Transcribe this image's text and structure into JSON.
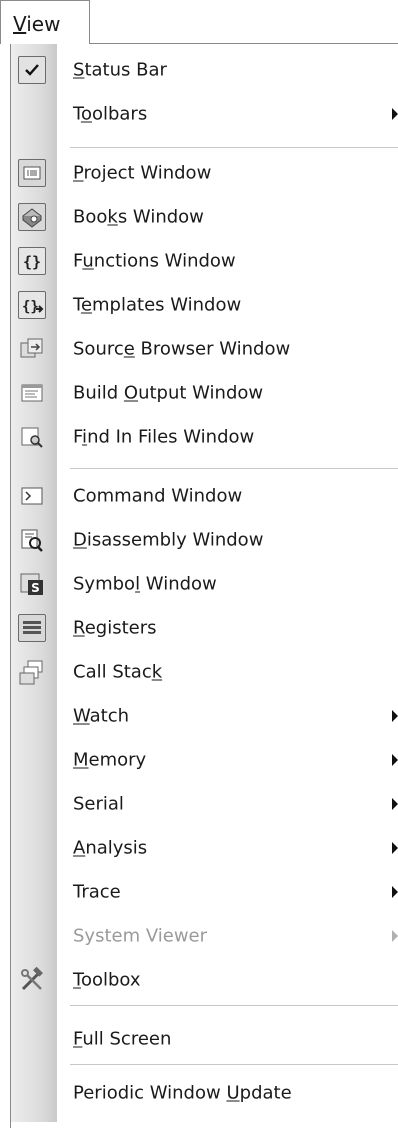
{
  "menubar": {
    "label_prefix": "",
    "label_underline": "V",
    "label_suffix": "iew"
  },
  "items": [
    {
      "pre": "",
      "u": "S",
      "post": "tatus Bar"
    },
    {
      "pre": "T",
      "u": "o",
      "post": "olbars"
    },
    {
      "pre": "",
      "u": "P",
      "post": "roject Window"
    },
    {
      "pre": "Boo",
      "u": "k",
      "post": "s Window"
    },
    {
      "pre": "F",
      "u": "u",
      "post": "nctions Window"
    },
    {
      "pre": "T",
      "u": "e",
      "post": "mplates Window"
    },
    {
      "pre": "Sourc",
      "u": "e",
      "post": " Browser Window"
    },
    {
      "pre": "Build ",
      "u": "O",
      "post": "utput Window"
    },
    {
      "pre": "F",
      "u": "i",
      "post": "nd In Files Window"
    },
    {
      "pre": "Command Window",
      "u": "",
      "post": ""
    },
    {
      "pre": "",
      "u": "D",
      "post": "isassembly Window"
    },
    {
      "pre": "Symbo",
      "u": "l",
      "post": " Window"
    },
    {
      "pre": "",
      "u": "R",
      "post": "egisters"
    },
    {
      "pre": "Call Stac",
      "u": "k",
      "post": ""
    },
    {
      "pre": "",
      "u": "W",
      "post": "atch"
    },
    {
      "pre": "",
      "u": "M",
      "post": "emory"
    },
    {
      "pre": "Serial",
      "u": "",
      "post": ""
    },
    {
      "pre": "",
      "u": "A",
      "post": "nalysis"
    },
    {
      "pre": "Trace",
      "u": "",
      "post": ""
    },
    {
      "pre": "System Viewer",
      "u": "",
      "post": ""
    },
    {
      "pre": "",
      "u": "T",
      "post": "oolbox"
    },
    {
      "pre": "",
      "u": "F",
      "post": "ull Screen"
    },
    {
      "pre": "Periodic Window ",
      "u": "U",
      "post": "pdate"
    }
  ],
  "state": {
    "status_bar_checked": true,
    "system_viewer_enabled": false
  }
}
